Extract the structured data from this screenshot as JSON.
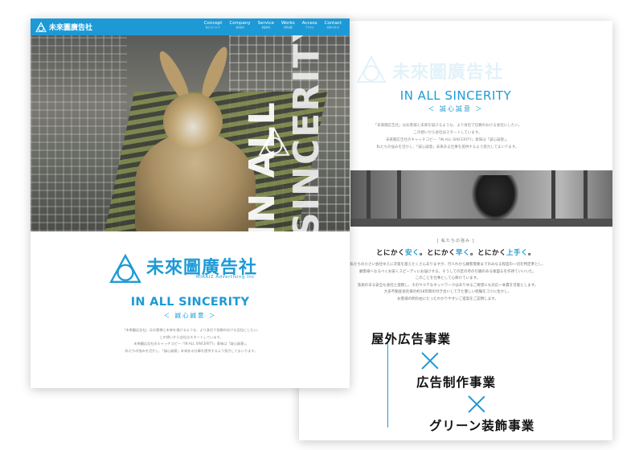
{
  "front": {
    "nav": {
      "logo_text": "未來圖廣告社",
      "items": [
        {
          "en": "Concept",
          "jp": "私たちについて"
        },
        {
          "en": "Company",
          "jp": "会社案内"
        },
        {
          "en": "Service",
          "jp": "事業内容"
        },
        {
          "en": "Works",
          "jp": "制作実績"
        },
        {
          "en": "Access",
          "jp": "アクセス"
        },
        {
          "en": "Contact",
          "jp": "お問い合わせ"
        }
      ]
    },
    "hero": {
      "vertical_line1": "IN ALL",
      "vertical_line2": "SINCERITY"
    },
    "brand": {
      "name": "未來圖廣告社",
      "sub": "MIRAIZ Advertising Inc"
    },
    "headline": "IN ALL SINCERITY",
    "subheadline": "＜ 誠心誠意 ＞",
    "paragraph": [
      "「未來圖広告社」はお客様と未来を描けるような、より身近で信頼のおける会社にしたい。",
      "この想いから会社はスタートしています。",
      "未來圖広告社のキャッチコピー「IN ALL SINCERITY」意味は「誠心誠意」。",
      "私たちの強みを活かし、「誠心誠意」未来ある仕事を提供するよう努力してまいります。"
    ]
  },
  "back": {
    "brand_name": "未來圖廣告社",
    "headline": "IN ALL SINCERITY",
    "subheadline": "＜ 誠心誠意 ＞",
    "paragraph": [
      "「未來圖広告社」はお客様と未来を描けるような、より身近で信頼のおける会社にしたい。",
      "この想いから会社はスタートしています。",
      "未來圖広告社のキャッチコピー「IN ALL SINCERITY」意味は「誠心誠意」。",
      "私たちの強みを活かし、「誠心誠意」未来ある仕事を提供するよう努力してまいります。"
    ],
    "strength_label": "[ 私たちの強み ]",
    "tagline": {
      "p1": "とにかく",
      "h1": "安く",
      "p2": "。とにかく",
      "h2": "早く",
      "p3": "。とにかく",
      "h3": "上手く",
      "p4": "。"
    },
    "paragraph2": [
      "私たちの小さい会社ゆえに次第を基えたくさんありますが、行人れから顧客需要までのみなる程度の一切を特定準とし、",
      "顧客様へなるべくお安くスピーディにお届けする。そうしての区の月の引銭のある後面るを作待ていいいた。",
      "このことを仕事として心掛けています。",
      "弦術のある安全も会社と提携し、そのヤルテなネットワークはありゆるご要望にも対応一本貫を可能とします。",
      "大多不動産会社様の約18年間の付き合いしてきた豊しい経験をコツに生かし、",
      "お客様の明の右にたったわかりやすいご提案をご説明します。"
    ],
    "services": [
      "屋外広告事業",
      "広告制作事業",
      "グリーン装飾事業"
    ]
  },
  "colors": {
    "accent": "#1d9ad6",
    "text_dark": "#111111",
    "text_muted": "#8a8a8a"
  }
}
